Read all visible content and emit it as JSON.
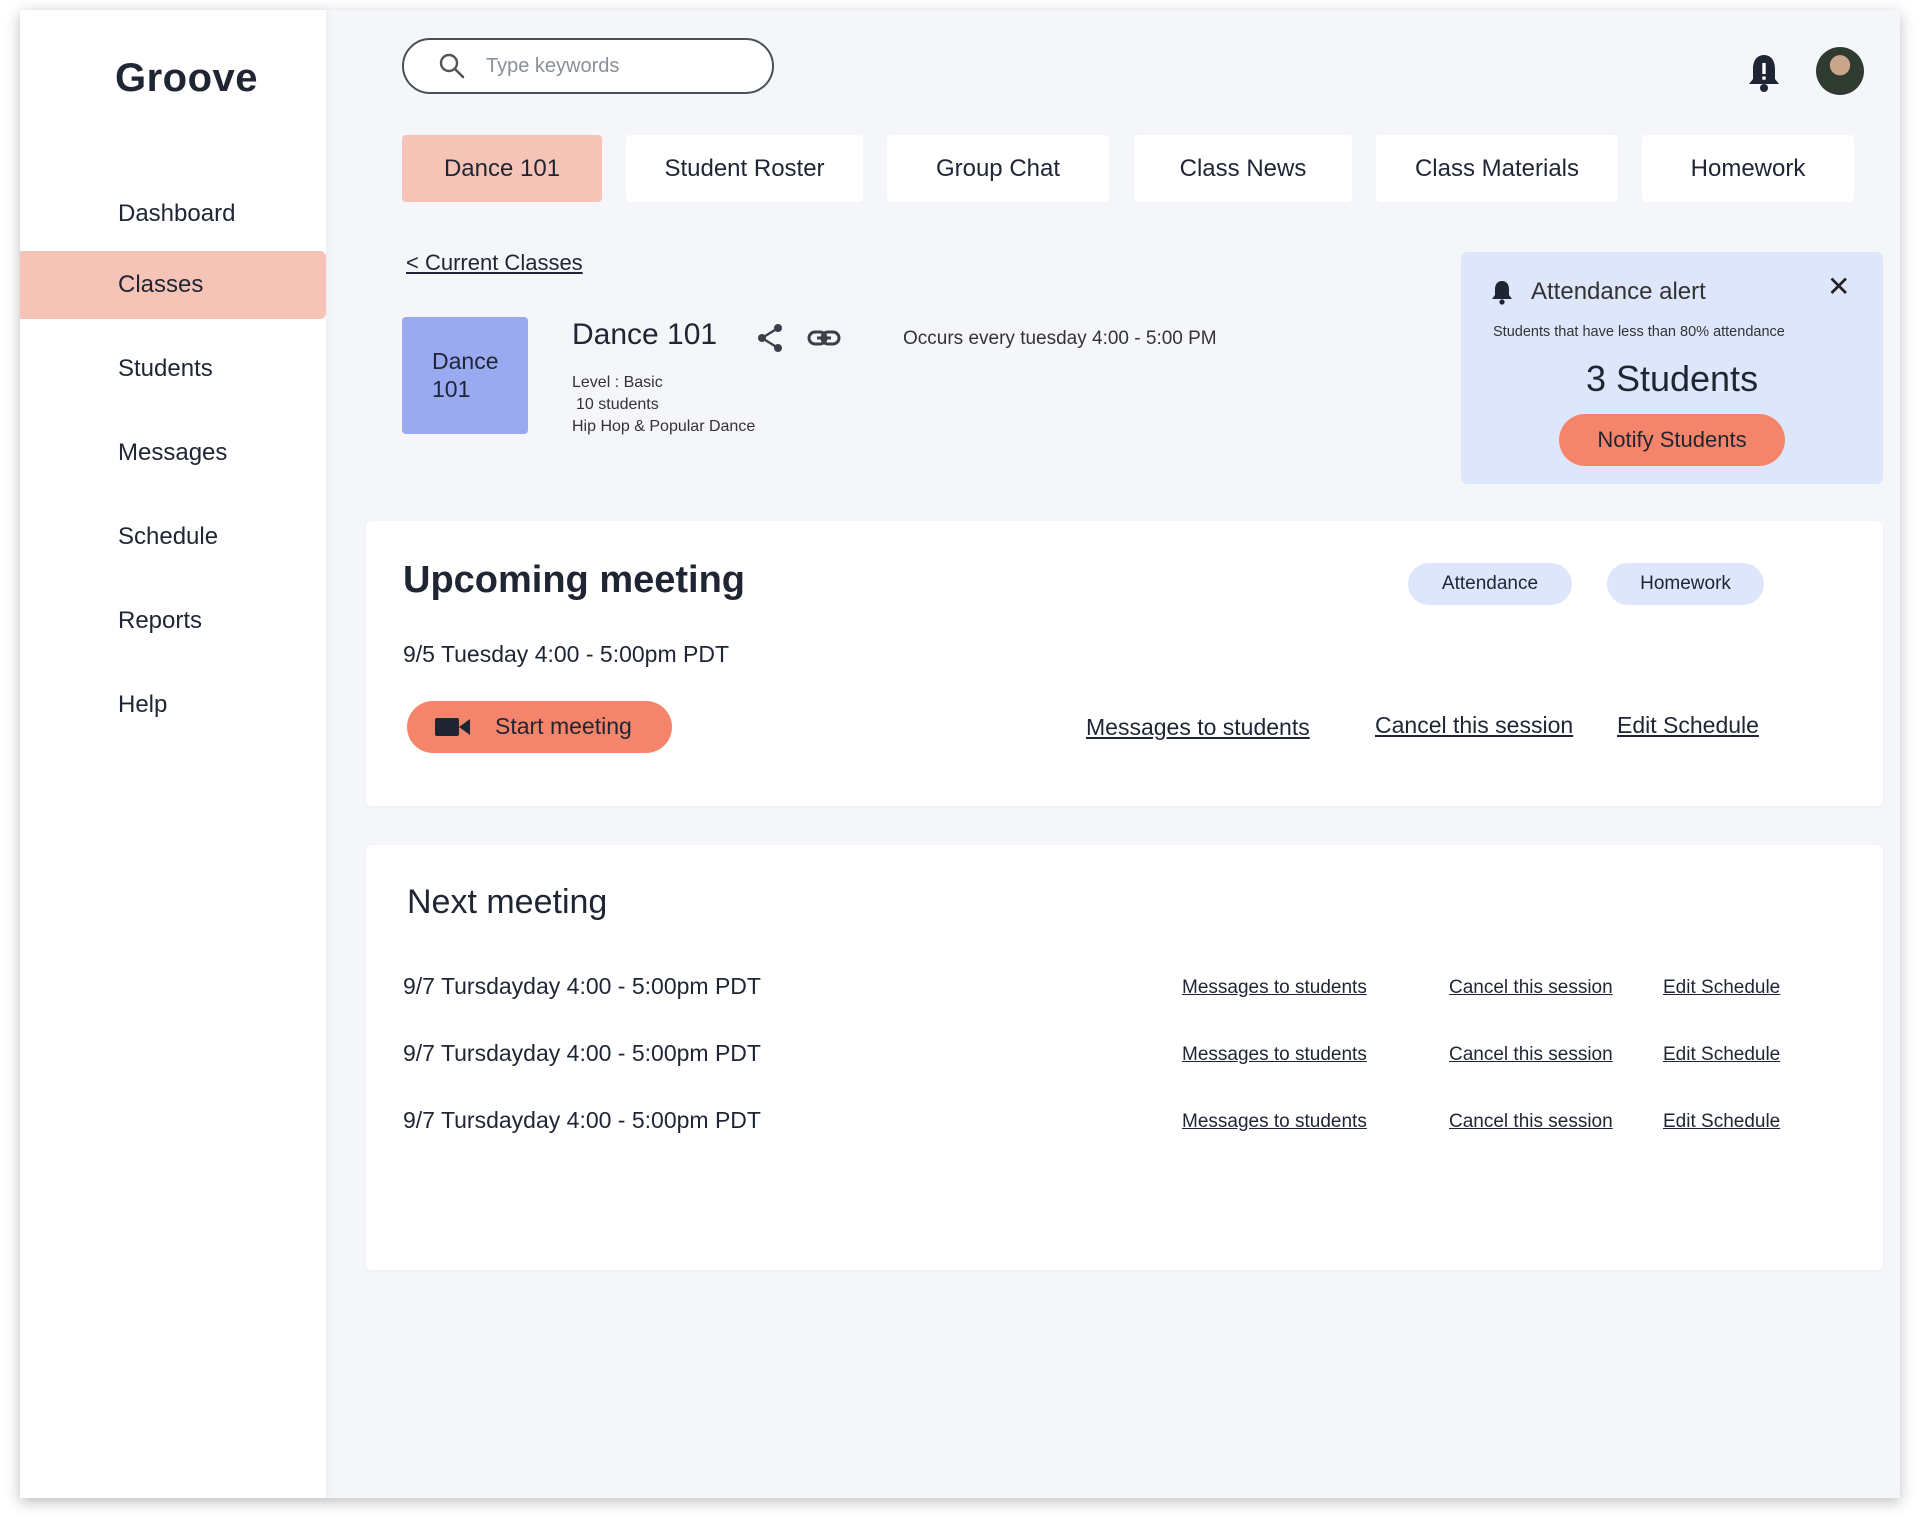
{
  "app": {
    "logo": "Groove"
  },
  "sidebar": {
    "items": [
      {
        "label": "Dashboard"
      },
      {
        "label": "Classes",
        "active": true
      },
      {
        "label": "Students"
      },
      {
        "label": "Messages"
      },
      {
        "label": "Schedule"
      },
      {
        "label": "Reports"
      },
      {
        "label": "Help"
      }
    ]
  },
  "header": {
    "search_placeholder": "Type keywords",
    "search_value": ""
  },
  "tabs": [
    {
      "label": "Dance 101",
      "active": true
    },
    {
      "label": "Student Roster"
    },
    {
      "label": "Group Chat"
    },
    {
      "label": "Class News"
    },
    {
      "label": "Class Materials"
    },
    {
      "label": "Homework"
    }
  ],
  "class_info": {
    "back_link": "< Current Classes",
    "thumb_line1": "Dance",
    "thumb_line2": "101",
    "title": "Dance 101",
    "occurs": "Occurs every tuesday 4:00 - 5:00 PM",
    "level": "Level : Basic",
    "students": "10 students",
    "genre": "Hip Hop  & Popular Dance"
  },
  "alert": {
    "title": "Attendance alert",
    "description": "Students that have less than 80% attendance",
    "count": "3 Students",
    "button": "Notify Students",
    "close": "✕"
  },
  "upcoming": {
    "title": "Upcoming meeting",
    "pill_attendance": "Attendance",
    "pill_homework": "Homework",
    "date": "9/5 Tuesday 4:00 - 5:00pm PDT",
    "start_button": "Start meeting",
    "link_messages": "Messages to students",
    "link_cancel": "Cancel this session",
    "link_edit": "Edit Schedule"
  },
  "next": {
    "title": "Next meeting",
    "rows": [
      {
        "date": "9/7 Tursdayday 4:00 - 5:00pm PDT",
        "messages": "Messages to students",
        "cancel": "Cancel this session",
        "edit": "Edit Schedule"
      },
      {
        "date": "9/7 Tursdayday 4:00 - 5:00pm PDT",
        "messages": "Messages to students",
        "cancel": "Cancel this session",
        "edit": "Edit Schedule"
      },
      {
        "date": "9/7 Tursdayday 4:00 - 5:00pm PDT",
        "messages": "Messages to students",
        "cancel": "Cancel this session",
        "edit": "Edit Schedule"
      }
    ]
  },
  "colors": {
    "accent_active": "#f6c4b7",
    "button_coral": "#f5856a",
    "pill_blue": "#dde6fb",
    "thumb_blue": "#9aaaf0",
    "background": "#f4f6fa"
  }
}
